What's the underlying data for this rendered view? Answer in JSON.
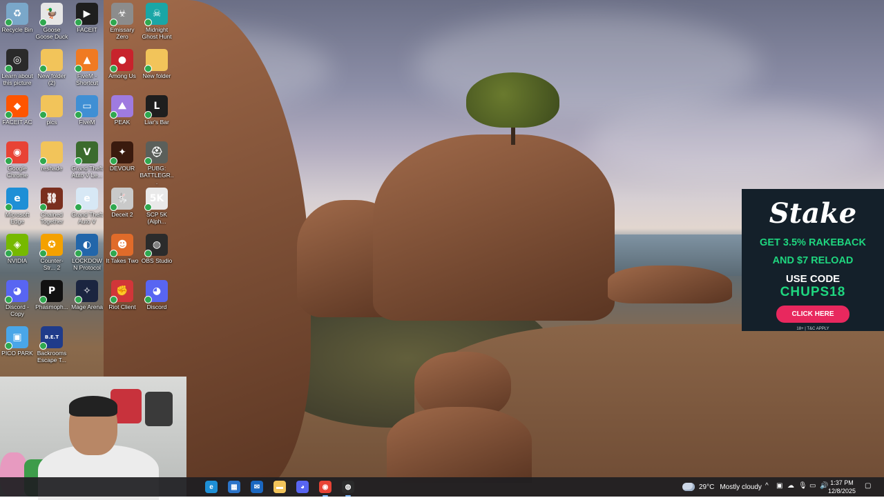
{
  "desktop_icons": [
    {
      "label": "Recycle Bin",
      "icon": "recycle-bin-icon",
      "color": "#7aa7c9",
      "glyph": "♻"
    },
    {
      "label": "Goose Goose Duck",
      "icon": "goose-goose-duck-icon",
      "color": "#e6e6e6",
      "glyph": "🦆"
    },
    {
      "label": "FACEIT",
      "icon": "faceit-icon",
      "color": "#1e1e1e",
      "glyph": "▶"
    },
    {
      "label": "Emissary Zero",
      "icon": "emissary-zero-icon",
      "color": "#8c8c8c",
      "glyph": "☣"
    },
    {
      "label": "Midnight Ghost Hunt",
      "icon": "midnight-ghost-hunt-icon",
      "color": "#1aa6a6",
      "glyph": "☠"
    },
    {
      "label": "Learn about this picture",
      "icon": "camera-icon",
      "color": "#2a2a2a",
      "glyph": "◎"
    },
    {
      "label": "New folder (2)",
      "icon": "folder-icon",
      "color": "#f2c45a",
      "glyph": ""
    },
    {
      "label": "FiveM - Shortcut",
      "icon": "fivem-icon",
      "color": "#f07a22",
      "glyph": "▲"
    },
    {
      "label": "Among Us",
      "icon": "among-us-icon",
      "color": "#c8232c",
      "glyph": "●"
    },
    {
      "label": "New folder",
      "icon": "folder-icon",
      "color": "#f2c45a",
      "glyph": ""
    },
    {
      "label": "FACEIT AC",
      "icon": "faceit-ac-icon",
      "color": "#ff5500",
      "glyph": "◆"
    },
    {
      "label": "pics",
      "icon": "folder-icon",
      "color": "#f2c45a",
      "glyph": ""
    },
    {
      "label": "FiveM",
      "icon": "fivem-window-icon",
      "color": "#3f8fd4",
      "glyph": "▭"
    },
    {
      "label": "PEAK",
      "icon": "peak-icon",
      "color": "#9f7be0",
      "glyph": "⛰"
    },
    {
      "label": "Liar's Bar",
      "icon": "liars-bar-icon",
      "color": "#1e1e1e",
      "glyph": "L"
    },
    {
      "label": "Google Chrome",
      "icon": "chrome-icon",
      "color": "#e84335",
      "glyph": "◉"
    },
    {
      "label": "reshade",
      "icon": "folder-icon",
      "color": "#f2c45a",
      "glyph": ""
    },
    {
      "label": "Grand Theft Auto V Le...",
      "icon": "gta-v-legacy-icon",
      "color": "#3b6b2e",
      "glyph": "V"
    },
    {
      "label": "DEVOUR",
      "icon": "devour-icon",
      "color": "#3a1a0e",
      "glyph": "✦"
    },
    {
      "label": "PUBG: BATTLEGR...",
      "icon": "pubg-icon",
      "color": "#5b5f5a",
      "glyph": "⛑"
    },
    {
      "label": "Microsoft Edge",
      "icon": "edge-icon",
      "color": "#1e8fd6",
      "glyph": "e"
    },
    {
      "label": "Chained Together",
      "icon": "chained-together-icon",
      "color": "#7a2f1e",
      "glyph": "⛓"
    },
    {
      "label": "Grand Theft Auto V",
      "icon": "gta-v-icon",
      "color": "#d7e8f5",
      "glyph": "e"
    },
    {
      "label": "Deceit 2",
      "icon": "deceit-2-icon",
      "color": "#c9c9c9",
      "glyph": "🐇"
    },
    {
      "label": "SCP 5K (Alph...",
      "icon": "scp-5k-icon",
      "color": "#e9e9e9",
      "glyph": "5K"
    },
    {
      "label": "NVIDIA",
      "icon": "nvidia-icon",
      "color": "#76b900",
      "glyph": "◈"
    },
    {
      "label": "Counter-Str... 2",
      "icon": "counter-strike-2-icon",
      "color": "#f4a100",
      "glyph": "✪"
    },
    {
      "label": "LOCKDOWN Protocol",
      "icon": "lockdown-protocol-icon",
      "color": "#2266aa",
      "glyph": "◐"
    },
    {
      "label": "It Takes Two",
      "icon": "it-takes-two-icon",
      "color": "#e06b2a",
      "glyph": "☻"
    },
    {
      "label": "OBS Studio",
      "icon": "obs-icon",
      "color": "#2b2b2b",
      "glyph": "◍"
    },
    {
      "label": "Discord - Copy",
      "icon": "discord-icon",
      "color": "#5865f2",
      "glyph": "◕"
    },
    {
      "label": "Phasmoph...",
      "icon": "phasmophobia-icon",
      "color": "#111111",
      "glyph": "P"
    },
    {
      "label": "Mage Arena",
      "icon": "mage-arena-icon",
      "color": "#1b2540",
      "glyph": "✧"
    },
    {
      "label": "Riot Client",
      "icon": "riot-client-icon",
      "color": "#d13639",
      "glyph": "✊"
    },
    {
      "label": "Discord",
      "icon": "discord-icon",
      "color": "#5865f2",
      "glyph": "◕"
    },
    {
      "label": "PICO PARK",
      "icon": "pico-park-icon",
      "color": "#4aa6e8",
      "glyph": "▣"
    },
    {
      "label": "Backrooms Escape T...",
      "icon": "backrooms-escape-icon",
      "color": "#1f3b8a",
      "glyph": "B.E.T"
    }
  ],
  "stake_ad": {
    "logo": "Stake",
    "promo_line1": "GET 3.5% RAKEBACK",
    "promo_line2": "AND $7 RELOAD",
    "use_code_label": "USE CODE",
    "code": "CHUPS18",
    "cta": "CLICK HERE",
    "fine_print": "18+ | T&C APPLY"
  },
  "taskbar": {
    "apps": [
      {
        "icon": "edge-icon",
        "color": "#1e8fd6",
        "glyph": "e",
        "active": false
      },
      {
        "icon": "store-icon",
        "color": "#2b74c9",
        "glyph": "▦",
        "active": false
      },
      {
        "icon": "outlook-icon",
        "color": "#1a67c1",
        "glyph": "✉",
        "active": false
      },
      {
        "icon": "file-explorer-icon",
        "color": "#f2c45a",
        "glyph": "▬",
        "active": false
      },
      {
        "icon": "discord-icon",
        "color": "#5865f2",
        "glyph": "◕",
        "active": false
      },
      {
        "icon": "chrome-icon",
        "color": "#e84335",
        "glyph": "◉",
        "active": true
      },
      {
        "icon": "obs-icon",
        "color": "#2b2b2b",
        "glyph": "◍",
        "active": true
      }
    ],
    "weather_temp": "29°C",
    "weather_desc": "Mostly cloudy",
    "time": "1:37 PM",
    "date": "12/8/2025"
  }
}
